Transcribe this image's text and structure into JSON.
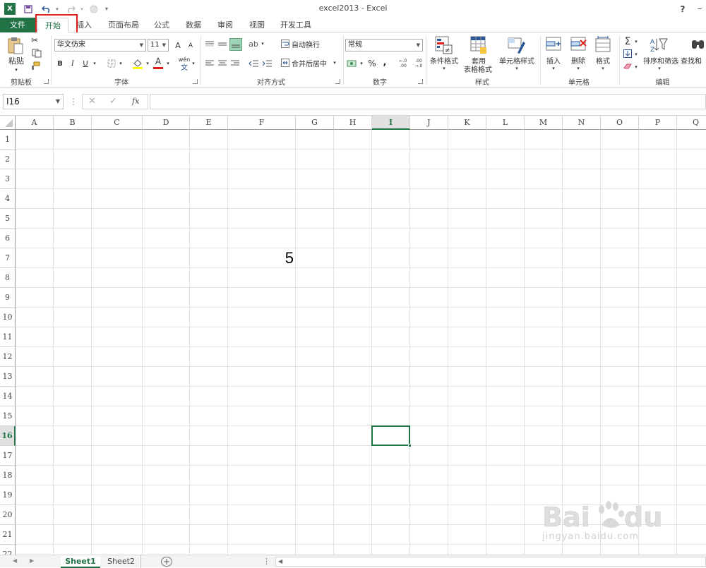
{
  "window": {
    "title": "excel2013 - Excel",
    "help": "?"
  },
  "tabs": {
    "file": "文件",
    "home": "开始",
    "insert": "插入",
    "page_layout": "页面布局",
    "formulas": "公式",
    "data": "数据",
    "review": "审阅",
    "view": "视图",
    "developer": "开发工具"
  },
  "ribbon": {
    "clipboard": {
      "paste": "粘贴",
      "label": "剪贴板"
    },
    "font": {
      "name": "华文仿宋",
      "size": "11",
      "bold": "B",
      "italic": "I",
      "underline": "U",
      "grow": "A",
      "shrink": "A",
      "color_a": "A",
      "phonetic": "wén",
      "phonetic_sub": "文",
      "label": "字体"
    },
    "alignment": {
      "wrap": "自动换行",
      "merge": "合并后居中",
      "label": "对齐方式"
    },
    "number": {
      "format": "常规",
      "percent": "%",
      "comma": ",",
      "inc": "←.0 .00",
      "dec": ".00 →.0",
      "label": "数字"
    },
    "styles": {
      "conditional": "条件格式",
      "table_1": "套用",
      "table_2": "表格格式",
      "cell_styles": "单元格样式",
      "label": "样式"
    },
    "cells": {
      "insert": "插入",
      "delete": "删除",
      "format": "格式",
      "label": "单元格"
    },
    "editing": {
      "sort": "排序和筛选",
      "find": "查找和",
      "label": "编辑"
    }
  },
  "formula_bar": {
    "name_box": "I16",
    "fx": "fx",
    "value": ""
  },
  "columns": [
    "A",
    "B",
    "C",
    "D",
    "E",
    "F",
    "G",
    "H",
    "I",
    "J",
    "K",
    "L",
    "M",
    "N",
    "O",
    "P",
    "Q"
  ],
  "rows": [
    "1",
    "2",
    "3",
    "4",
    "5",
    "6",
    "7",
    "8",
    "9",
    "10",
    "11",
    "12",
    "13",
    "14",
    "15",
    "16",
    "17",
    "18",
    "19",
    "20",
    "21",
    "22"
  ],
  "cells": {
    "F7": "5"
  },
  "selected_cell": "I16",
  "sheets": [
    "Sheet1",
    "Sheet2"
  ],
  "active_sheet": "Sheet1",
  "watermark": {
    "brand": "Baidu经验",
    "url": "jingyan.baidu.com"
  },
  "colors": {
    "accent": "#217346",
    "highlight_box": "#e0201a"
  }
}
